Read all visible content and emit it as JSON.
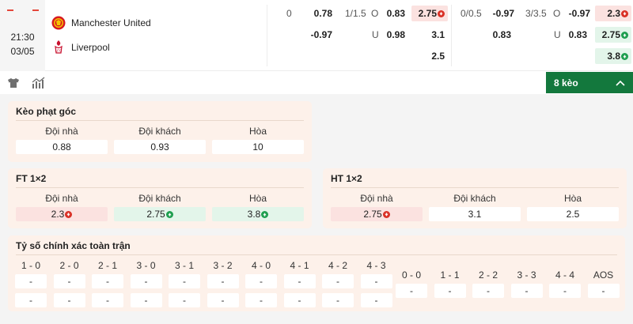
{
  "match": {
    "time": "21:30",
    "date": "03/05",
    "home": "Manchester United",
    "away": "Liverpool",
    "away_crest_text": "LFC",
    "live_marker": "-"
  },
  "odds": {
    "ft_hdp_line": "0",
    "ft_hdp_home": "0.78",
    "ft_hdp_away": "-0.97",
    "ft_ou_line": "1/1.5",
    "ft_ou_o_label": "O",
    "ft_ou_o": "0.83",
    "ft_ou_u_label": "U",
    "ft_ou_u": "0.98",
    "ft_1x2_home": "2.75",
    "ft_1x2_away": "3.1",
    "ft_1x2_draw": "2.5",
    "ht_hdp_line": "0/0.5",
    "ht_hdp_home": "-0.97",
    "ht_hdp_away": "0.83",
    "ht_ou_line": "3/3.5",
    "ht_ou_o_label": "O",
    "ht_ou_o": "-0.97",
    "ht_ou_u_label": "U",
    "ht_ou_u": "0.83",
    "ht_1x2_home": "2.3",
    "ht_1x2_away": "2.75",
    "ht_1x2_draw": "3.8"
  },
  "toolbar": {
    "keo_button": "8 kèo"
  },
  "corner": {
    "title": "Kèo phạt góc",
    "headers": [
      "Đội nhà",
      "Đội khách",
      "Hòa"
    ],
    "values": [
      "0.88",
      "0.93",
      "10"
    ]
  },
  "ft1x2": {
    "title": "FT 1×2",
    "headers": [
      "Đội nhà",
      "Đội khách",
      "Hòa"
    ],
    "values": [
      "2.3",
      "2.75",
      "3.8"
    ]
  },
  "ht1x2": {
    "title": "HT 1×2",
    "headers": [
      "Đội nhà",
      "Đội khách",
      "Hòa"
    ],
    "values": [
      "2.75",
      "3.1",
      "2.5"
    ]
  },
  "correct_score": {
    "title": "Tỷ số chính xác toàn trận",
    "left_headers": [
      "1 - 0",
      "2 - 0",
      "2 - 1",
      "3 - 0",
      "3 - 1",
      "3 - 2",
      "4 - 0",
      "4 - 1",
      "4 - 2",
      "4 - 3"
    ],
    "left_row1": [
      "-",
      "-",
      "-",
      "-",
      "-",
      "-",
      "-",
      "-",
      "-",
      "-"
    ],
    "left_row2": [
      "-",
      "-",
      "-",
      "-",
      "-",
      "-",
      "-",
      "-",
      "-",
      "-"
    ],
    "right_headers": [
      "0 - 0",
      "1 - 1",
      "2 - 2",
      "3 - 3",
      "4 - 4",
      "AOS"
    ],
    "right_row": [
      "-",
      "-",
      "-",
      "-",
      "-",
      "-"
    ]
  },
  "colors": {
    "accent_green": "#13783d",
    "odd_up": "#1e9e4f",
    "odd_down": "#d93025",
    "card_bg": "#fdf1ea",
    "red_bg": "#fbe2e0",
    "green_bg": "#e3f5ea"
  },
  "icons": {
    "shirt": "shirt-icon",
    "stats": "stats-chart-icon",
    "collapse": "chevron-up-icon",
    "home_crest": "manchester-united-crest-icon",
    "away_crest": "liverpool-crest-icon"
  }
}
